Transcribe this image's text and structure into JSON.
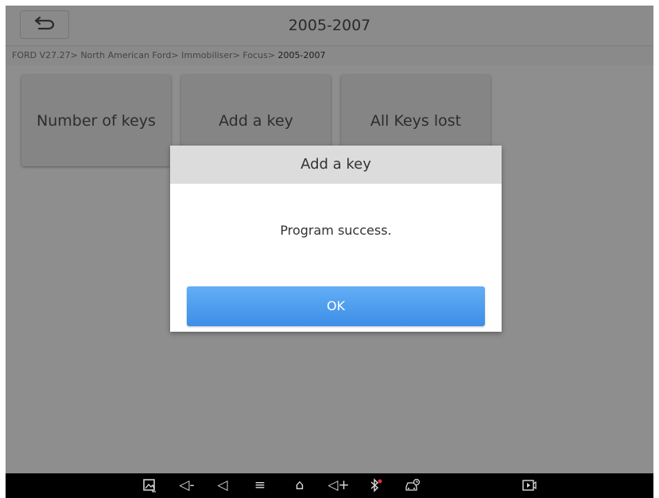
{
  "header": {
    "title": "2005-2007",
    "back_icon": "back-arrow-icon"
  },
  "breadcrumb": {
    "path": "FORD V27.27> North American Ford> Immobiliser> Focus> ",
    "current": "2005-2007"
  },
  "tiles": [
    {
      "label": "Number of keys"
    },
    {
      "label": "Add a key"
    },
    {
      "label": "All Keys lost"
    }
  ],
  "dialog": {
    "title": "Add a key",
    "message": "Program success.",
    "ok_label": "OK"
  },
  "navbar": {
    "icons": [
      "screenshot-icon",
      "volume-down-icon",
      "back-icon",
      "menu-icon",
      "home-icon",
      "volume-up-icon",
      "bluetooth-icon",
      "vehicle-diagnostics-icon",
      "screen-record-icon"
    ],
    "volume_down": "◁-",
    "back": "◁",
    "menu": "≡",
    "home": "⌂",
    "volume_up": "◁+",
    "bluetooth": "✱"
  },
  "colors": {
    "ok_button": "#4a9cef",
    "dialog_header": "#dcdcdc",
    "overlay": "#8e8e8e",
    "bluetooth_dot": "#e03030"
  }
}
